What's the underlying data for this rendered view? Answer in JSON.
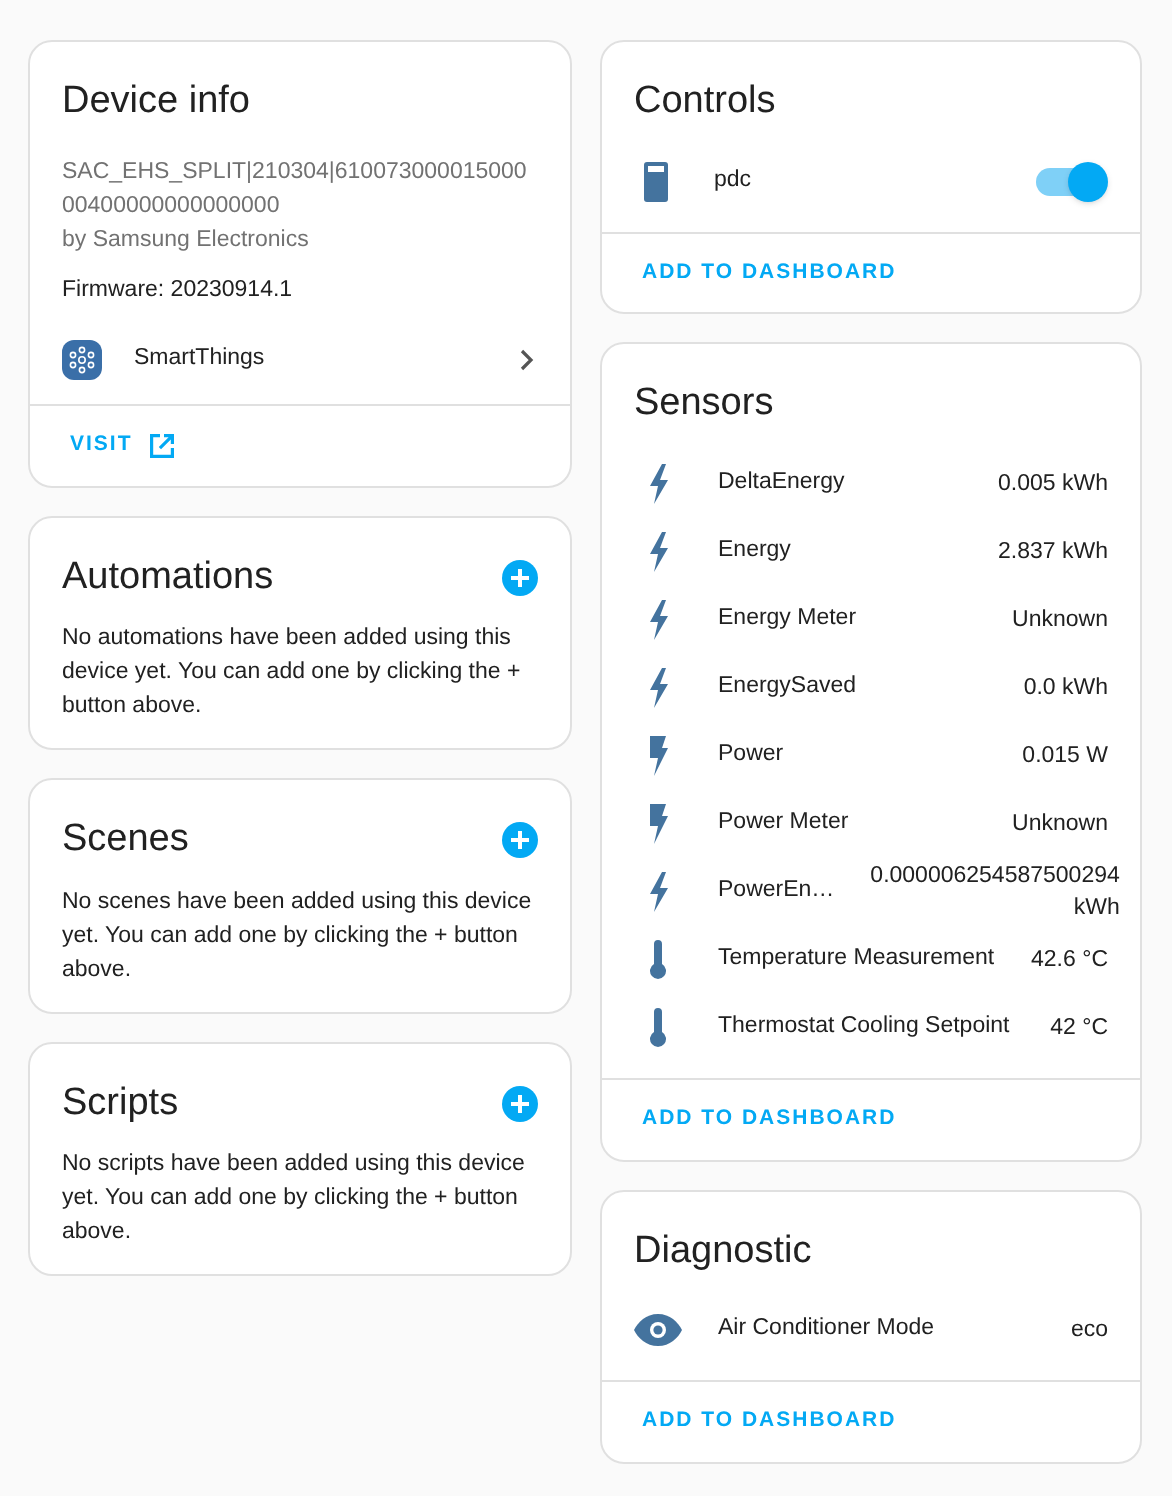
{
  "device_info": {
    "title": "Device info",
    "model": "SAC_EHS_SPLIT|210304|61007300001500000400000000000000",
    "manufacturer": "by Samsung Electronics",
    "firmware": "Firmware: 20230914.1",
    "integration": {
      "name": "SmartThings"
    },
    "action": "VISIT"
  },
  "related": [
    {
      "title": "Automations",
      "message": "No automations have been added using this device yet. You can add one by clicking the + button above."
    },
    {
      "title": "Scenes",
      "message": "No scenes have been added using this device yet. You can add one by clicking the + button above."
    },
    {
      "title": "Scripts",
      "message": "No scripts have been added using this device yet. You can add one by clicking the + button above."
    }
  ],
  "controls": {
    "title": "Controls",
    "items": [
      {
        "kind": "switch",
        "name": "pdc",
        "on": true
      }
    ],
    "action": "ADD TO DASHBOARD"
  },
  "sensors": {
    "title": "Sensors",
    "items": [
      {
        "kind": "energy",
        "name": "DeltaEnergy",
        "value": "0.005 kWh"
      },
      {
        "kind": "energy",
        "name": "Energy",
        "value": "2.837 kWh"
      },
      {
        "kind": "energy",
        "name": "Energy Meter",
        "value": "Unknown"
      },
      {
        "kind": "energy",
        "name": "EnergySaved",
        "value": "0.0 kWh"
      },
      {
        "kind": "power",
        "name": "Power",
        "value": "0.015 W"
      },
      {
        "kind": "power",
        "name": "Power Meter",
        "value": "Unknown"
      },
      {
        "kind": "energy",
        "name": "PowerEn…",
        "value": "0.000006254587500294 kWh"
      },
      {
        "kind": "temperature",
        "name": "Temperature Measurement",
        "value": "42.6 °C"
      },
      {
        "kind": "temperature",
        "name": "Thermostat Cooling Setpoint",
        "value": "42 °C"
      }
    ],
    "action": "ADD TO DASHBOARD"
  },
  "diagnostic": {
    "title": "Diagnostic",
    "items": [
      {
        "kind": "mode",
        "name": "Air Conditioner Mode",
        "value": "eco"
      }
    ],
    "action": "ADD TO DASHBOARD"
  }
}
